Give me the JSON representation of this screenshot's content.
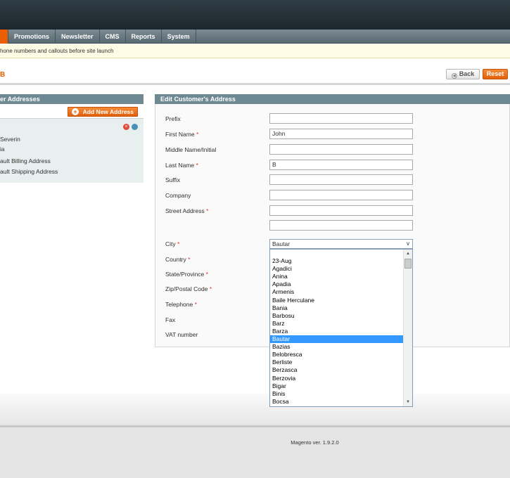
{
  "nav": {
    "items": [
      "Promotions",
      "Newsletter",
      "CMS",
      "Reports",
      "System"
    ]
  },
  "notice": "hone numbers and callouts before site launch",
  "page": {
    "title": "B",
    "back_label": "Back",
    "reset_label": "Reset"
  },
  "left_panel": {
    "title": "er Addresses",
    "add_button": "Add New Address",
    "address_lines": [
      "Severin",
      "ia",
      "ault Billing Address",
      "ault Shipping Address"
    ]
  },
  "form": {
    "title": "Edit Customer's Address",
    "fields": {
      "prefix": {
        "label": "Prefix",
        "value": ""
      },
      "first_name": {
        "label": "First Name",
        "value": "John"
      },
      "middle_name": {
        "label": "Middle Name/Initial",
        "value": ""
      },
      "last_name": {
        "label": "Last Name",
        "value": "B"
      },
      "suffix": {
        "label": "Suffix",
        "value": ""
      },
      "company": {
        "label": "Company",
        "value": ""
      },
      "street": {
        "label": "Street Address",
        "value": ""
      },
      "city": {
        "label": "City",
        "value": "Bautar"
      },
      "country": {
        "label": "Country"
      },
      "state": {
        "label": "State/Province"
      },
      "zip": {
        "label": "Zip/Postal Code"
      },
      "telephone": {
        "label": "Telephone"
      },
      "fax": {
        "label": "Fax"
      },
      "vat": {
        "label": "VAT number"
      }
    },
    "required_mark": "*"
  },
  "city_options": [
    "23-Aug",
    "Agadici",
    "Anina",
    "Apadia",
    "Armenis",
    "Baile Herculane",
    "Bania",
    "Barbosu",
    "Barz",
    "Barza",
    "Bautar",
    "Bazias",
    "Belobresca",
    "Berliste",
    "Berzasca",
    "Berzovia",
    "Bigar",
    "Binis",
    "Bocsa"
  ],
  "city_selected_index": 10,
  "footer": {
    "version": "Magento ver. 1.9.2.0"
  }
}
